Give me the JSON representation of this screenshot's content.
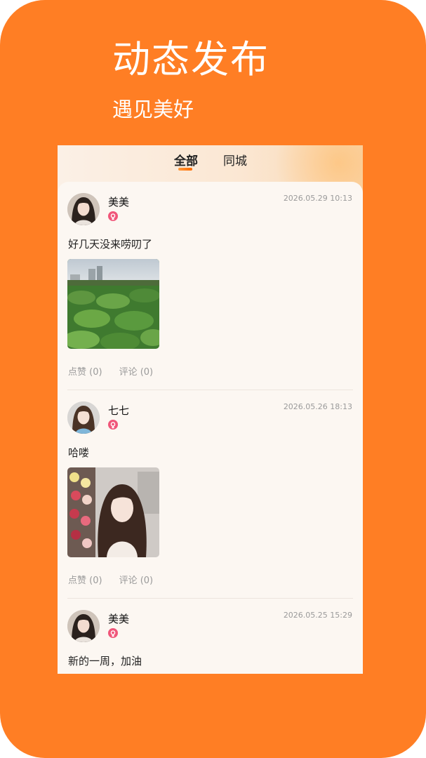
{
  "promo": {
    "title": "动态发布",
    "subtitle": "遇见美好",
    "background_color": "#FF7E24"
  },
  "tabs": [
    {
      "label": "全部",
      "active": true
    },
    {
      "label": "同城",
      "active": false
    }
  ],
  "posts": [
    {
      "username": "美美",
      "timestamp": "2026.05.29 10:13",
      "text": "好几天没来唠叨了",
      "image": "lotus-pond-photo",
      "likes_label": "点赞 (0)",
      "comments_label": "评论 (0)"
    },
    {
      "username": "七七",
      "timestamp": "2026.05.26 18:13",
      "text": "哈喽",
      "image": "woman-with-roses-photo",
      "likes_label": "点赞 (0)",
      "comments_label": "评论 (0)"
    },
    {
      "username": "美美",
      "timestamp": "2026.05.25 15:29",
      "text": "新的一周，加油"
    }
  ],
  "colors": {
    "accent": "#FF7E24",
    "female_badge": "#F0567A"
  }
}
